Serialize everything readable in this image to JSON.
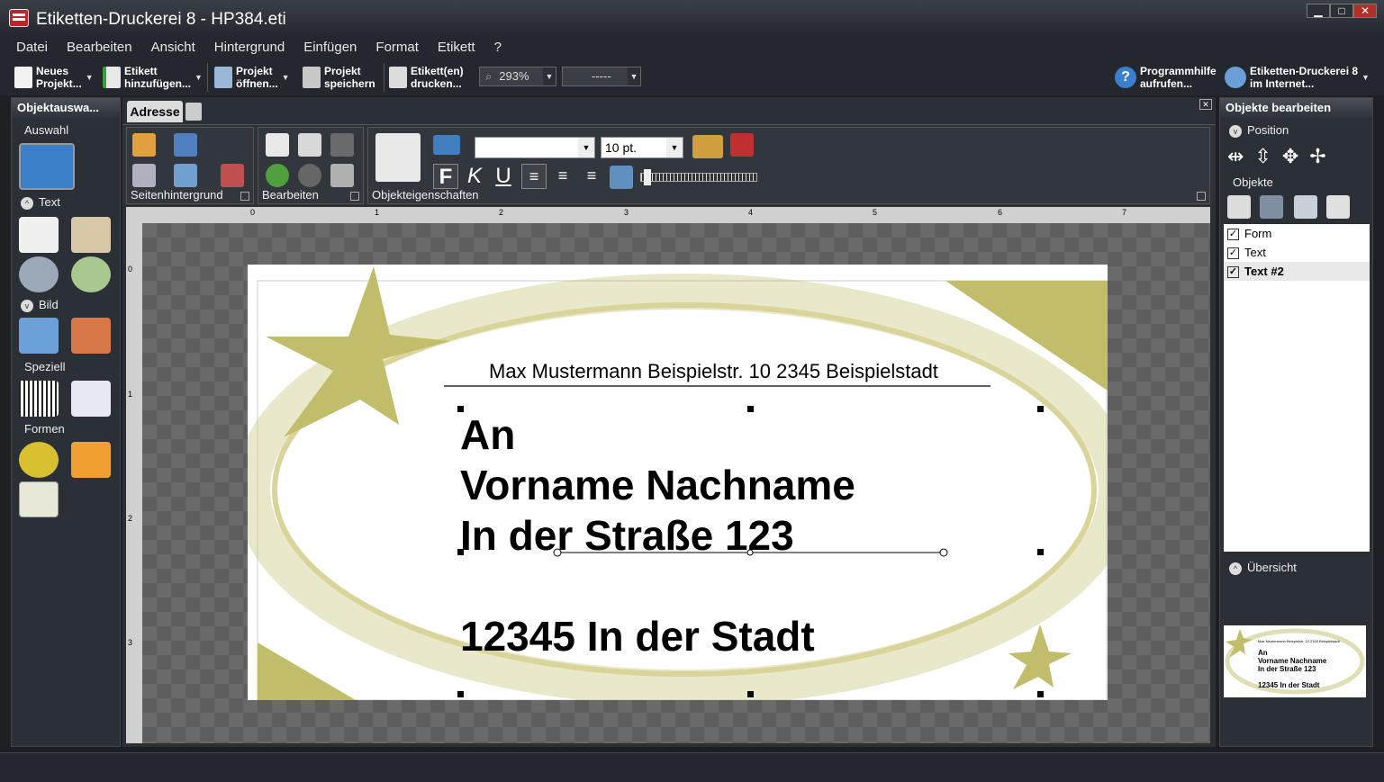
{
  "window": {
    "title": "Etiketten-Druckerei 8 - HP384.eti",
    "buttons": [
      "▁",
      "□",
      "✕"
    ]
  },
  "menu": [
    "Datei",
    "Bearbeiten",
    "Ansicht",
    "Hintergrund",
    "Einfügen",
    "Format",
    "Etikett",
    "?"
  ],
  "toolbar": {
    "new_project": "Neues\nProjekt...",
    "add_label": "Etikett\nhinzufügen...",
    "open_project": "Projekt\nöffnen...",
    "save_project": "Projekt\nspeichern",
    "print_labels": "Etikett(en)\ndrucken...",
    "zoom": "293%",
    "layer": "-----",
    "help": "Programmhilfe\naufrufen...",
    "internet": "Etiketten-Druckerei 8\nim Internet..."
  },
  "left_panel": {
    "title": "Objektauswa...",
    "sections": {
      "selection": "Auswahl",
      "text": "Text",
      "image": "Bild",
      "special": "Speziell",
      "shapes": "Formen"
    }
  },
  "tabs": {
    "active": "Adresse"
  },
  "ribbon": {
    "groups": [
      "Seitenhintergrund",
      "Bearbeiten",
      "Objekteigenschaften"
    ],
    "font_name": "",
    "font_size": "10 pt.",
    "bold": "F",
    "italic": "K",
    "underline": "U"
  },
  "ruler": {
    "h_ticks": [
      "0",
      "1",
      "2",
      "3",
      "4",
      "5",
      "6",
      "7"
    ],
    "v_ticks": [
      "0",
      "1",
      "2",
      "3"
    ]
  },
  "label": {
    "sender": "Max Mustermann Beispielstr. 10 2345 Beispielstadt",
    "line1": "An",
    "line2": "Vorname Nachname",
    "line3": "In der Straße 123",
    "line4": "12345 In der Stadt",
    "colors": {
      "accent": "#c2bd6a"
    }
  },
  "right_panel": {
    "title": "Objekte bearbeiten",
    "position": "Position",
    "objects": "Objekte",
    "overview": "Übersicht",
    "items": [
      {
        "label": "Form",
        "checked": true
      },
      {
        "label": "Text",
        "checked": true
      },
      {
        "label": "Text #2",
        "checked": true,
        "bold": true
      }
    ]
  }
}
